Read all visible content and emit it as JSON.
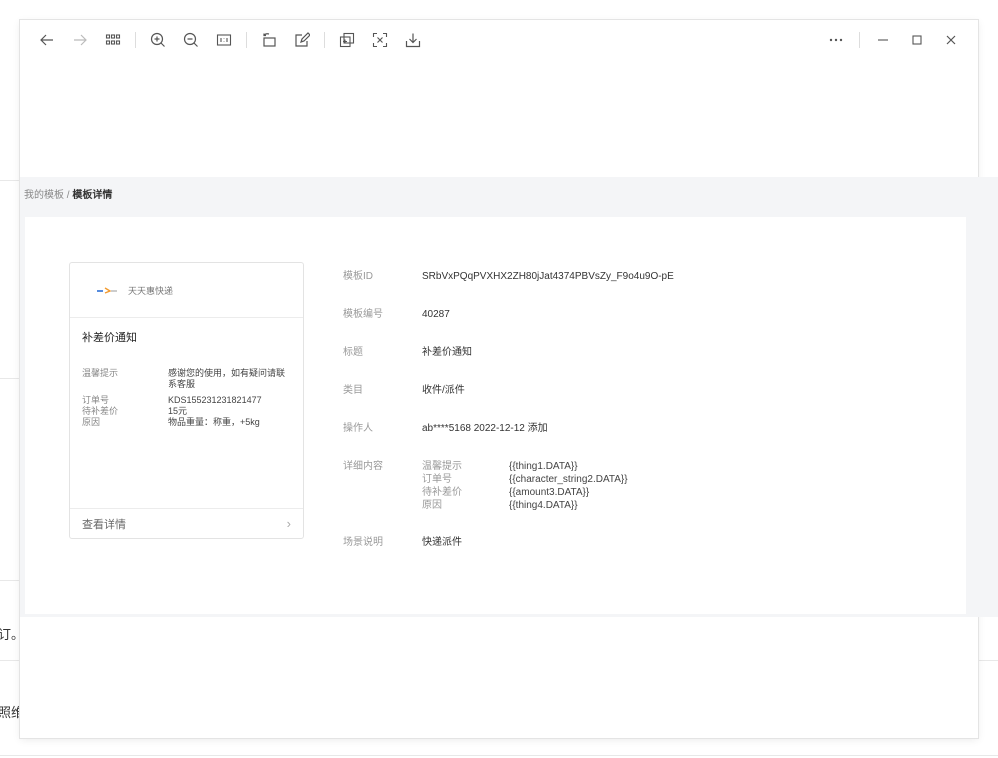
{
  "background": {
    "fragment_1": "订。",
    "fragment_2": "照维"
  },
  "toolbar": {
    "left": [
      {
        "name": "back",
        "icon": "arrow-left-icon",
        "disabled": false
      },
      {
        "name": "forward",
        "icon": "arrow-right-icon",
        "disabled": true
      },
      {
        "name": "grid",
        "icon": "grid-icon",
        "disabled": false
      },
      {
        "name": "zoom-in",
        "icon": "zoom-in-icon",
        "disabled": false
      },
      {
        "name": "zoom-out",
        "icon": "zoom-out-icon",
        "disabled": false
      },
      {
        "name": "actual-size",
        "icon": "actual-size-icon",
        "disabled": false
      },
      {
        "name": "rotate",
        "icon": "rotate-icon",
        "disabled": false
      },
      {
        "name": "edit",
        "icon": "edit-icon",
        "disabled": false
      },
      {
        "name": "copy",
        "icon": "copy-icon",
        "disabled": false
      },
      {
        "name": "extract-text",
        "icon": "extract-text-icon",
        "disabled": false
      },
      {
        "name": "download",
        "icon": "download-icon",
        "disabled": false
      }
    ],
    "right": [
      "more-icon",
      "minimize-icon",
      "maximize-icon",
      "close-icon"
    ]
  },
  "breadcrumb": {
    "parent": "我的模板",
    "separator": " / ",
    "current": "模板详情"
  },
  "card": {
    "brand": "天天惠快递",
    "title": "补差价通知",
    "rows": [
      {
        "key": "温馨提示",
        "value": "感谢您的使用，如有疑问请联系客服"
      },
      {
        "key": "订单号",
        "value": "KDS155231231821477"
      },
      {
        "key": "待补差价",
        "value": "15元"
      },
      {
        "key": "原因",
        "value": "物品重量：称重，+5kg"
      }
    ],
    "footer": "查看详情",
    "footer_arrow": "›"
  },
  "details": {
    "template_id": {
      "label": "模板ID",
      "value": "SRbVxPQqPVXHX2ZH80jJat4374PBVsZy_F9o4u9O-pE"
    },
    "template_no": {
      "label": "模板编号",
      "value": "40287"
    },
    "title": {
      "label": "标题",
      "value": "补差价通知"
    },
    "category": {
      "label": "类目",
      "value": "收件/派件"
    },
    "operator": {
      "label": "操作人",
      "value": "ab****5168 2022-12-12 添加"
    },
    "content": {
      "label": "详细内容",
      "lines": [
        {
          "key": "温馨提示",
          "value": "{{thing1.DATA}}"
        },
        {
          "key": "订单号",
          "value": "{{character_string2.DATA}}"
        },
        {
          "key": "待补差价",
          "value": "{{amount3.DATA}}"
        },
        {
          "key": "原因",
          "value": "{{thing4.DATA}}"
        }
      ]
    },
    "scene": {
      "label": "场景说明",
      "value": "快递派件"
    }
  }
}
